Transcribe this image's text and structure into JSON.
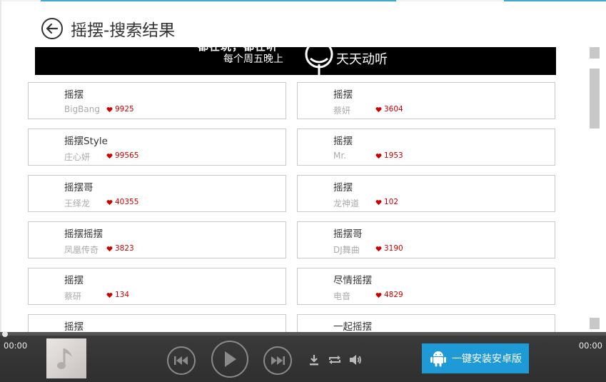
{
  "header": {
    "title": "摇摆-搜索结果"
  },
  "banner": {
    "top_text": "都在玩，都在听",
    "subtitle": "每个周五晚上",
    "main_text": "天天动听"
  },
  "results": [
    {
      "title": "摇摆",
      "artist": "BigBang",
      "likes": "9925"
    },
    {
      "title": "摇摆",
      "artist": "蔡妍",
      "likes": "3604"
    },
    {
      "title": "摇摆Style",
      "artist": "庄心妍",
      "likes": "99565"
    },
    {
      "title": "摇摆",
      "artist": "Mr.",
      "likes": "1953"
    },
    {
      "title": "摇摆哥",
      "artist": "王绎龙",
      "likes": "40355"
    },
    {
      "title": "摇摆",
      "artist": "龙神道",
      "likes": "102"
    },
    {
      "title": "摇摆摇摆",
      "artist": "凤凰传奇",
      "likes": "3823"
    },
    {
      "title": "摇摆哥",
      "artist": "DJ舞曲",
      "likes": "3190"
    },
    {
      "title": "摇摆",
      "artist": "蔡研",
      "likes": "134"
    },
    {
      "title": "尽情摇摆",
      "artist": "电音",
      "likes": "4829"
    },
    {
      "title": "摇摆",
      "artist": "",
      "likes": ""
    },
    {
      "title": "一起摇摆",
      "artist": "",
      "likes": ""
    }
  ],
  "player": {
    "elapsed": "00:00",
    "duration": "00:00",
    "progress": 0,
    "install_label": "一键安装安卓版"
  },
  "colors": {
    "accent": "#3fa9c9",
    "install_button": "#1e9ad6",
    "like_heart": "#cc0000",
    "player_bg": "#353535"
  },
  "icons": {
    "back": "back-arrow-icon",
    "heart": "heart-icon",
    "music_note": "music-note-icon",
    "prev": "previous-track-icon",
    "play": "play-icon",
    "next": "next-track-icon",
    "download": "download-icon",
    "repeat": "repeat-icon",
    "volume": "volume-icon",
    "android": "android-icon"
  }
}
